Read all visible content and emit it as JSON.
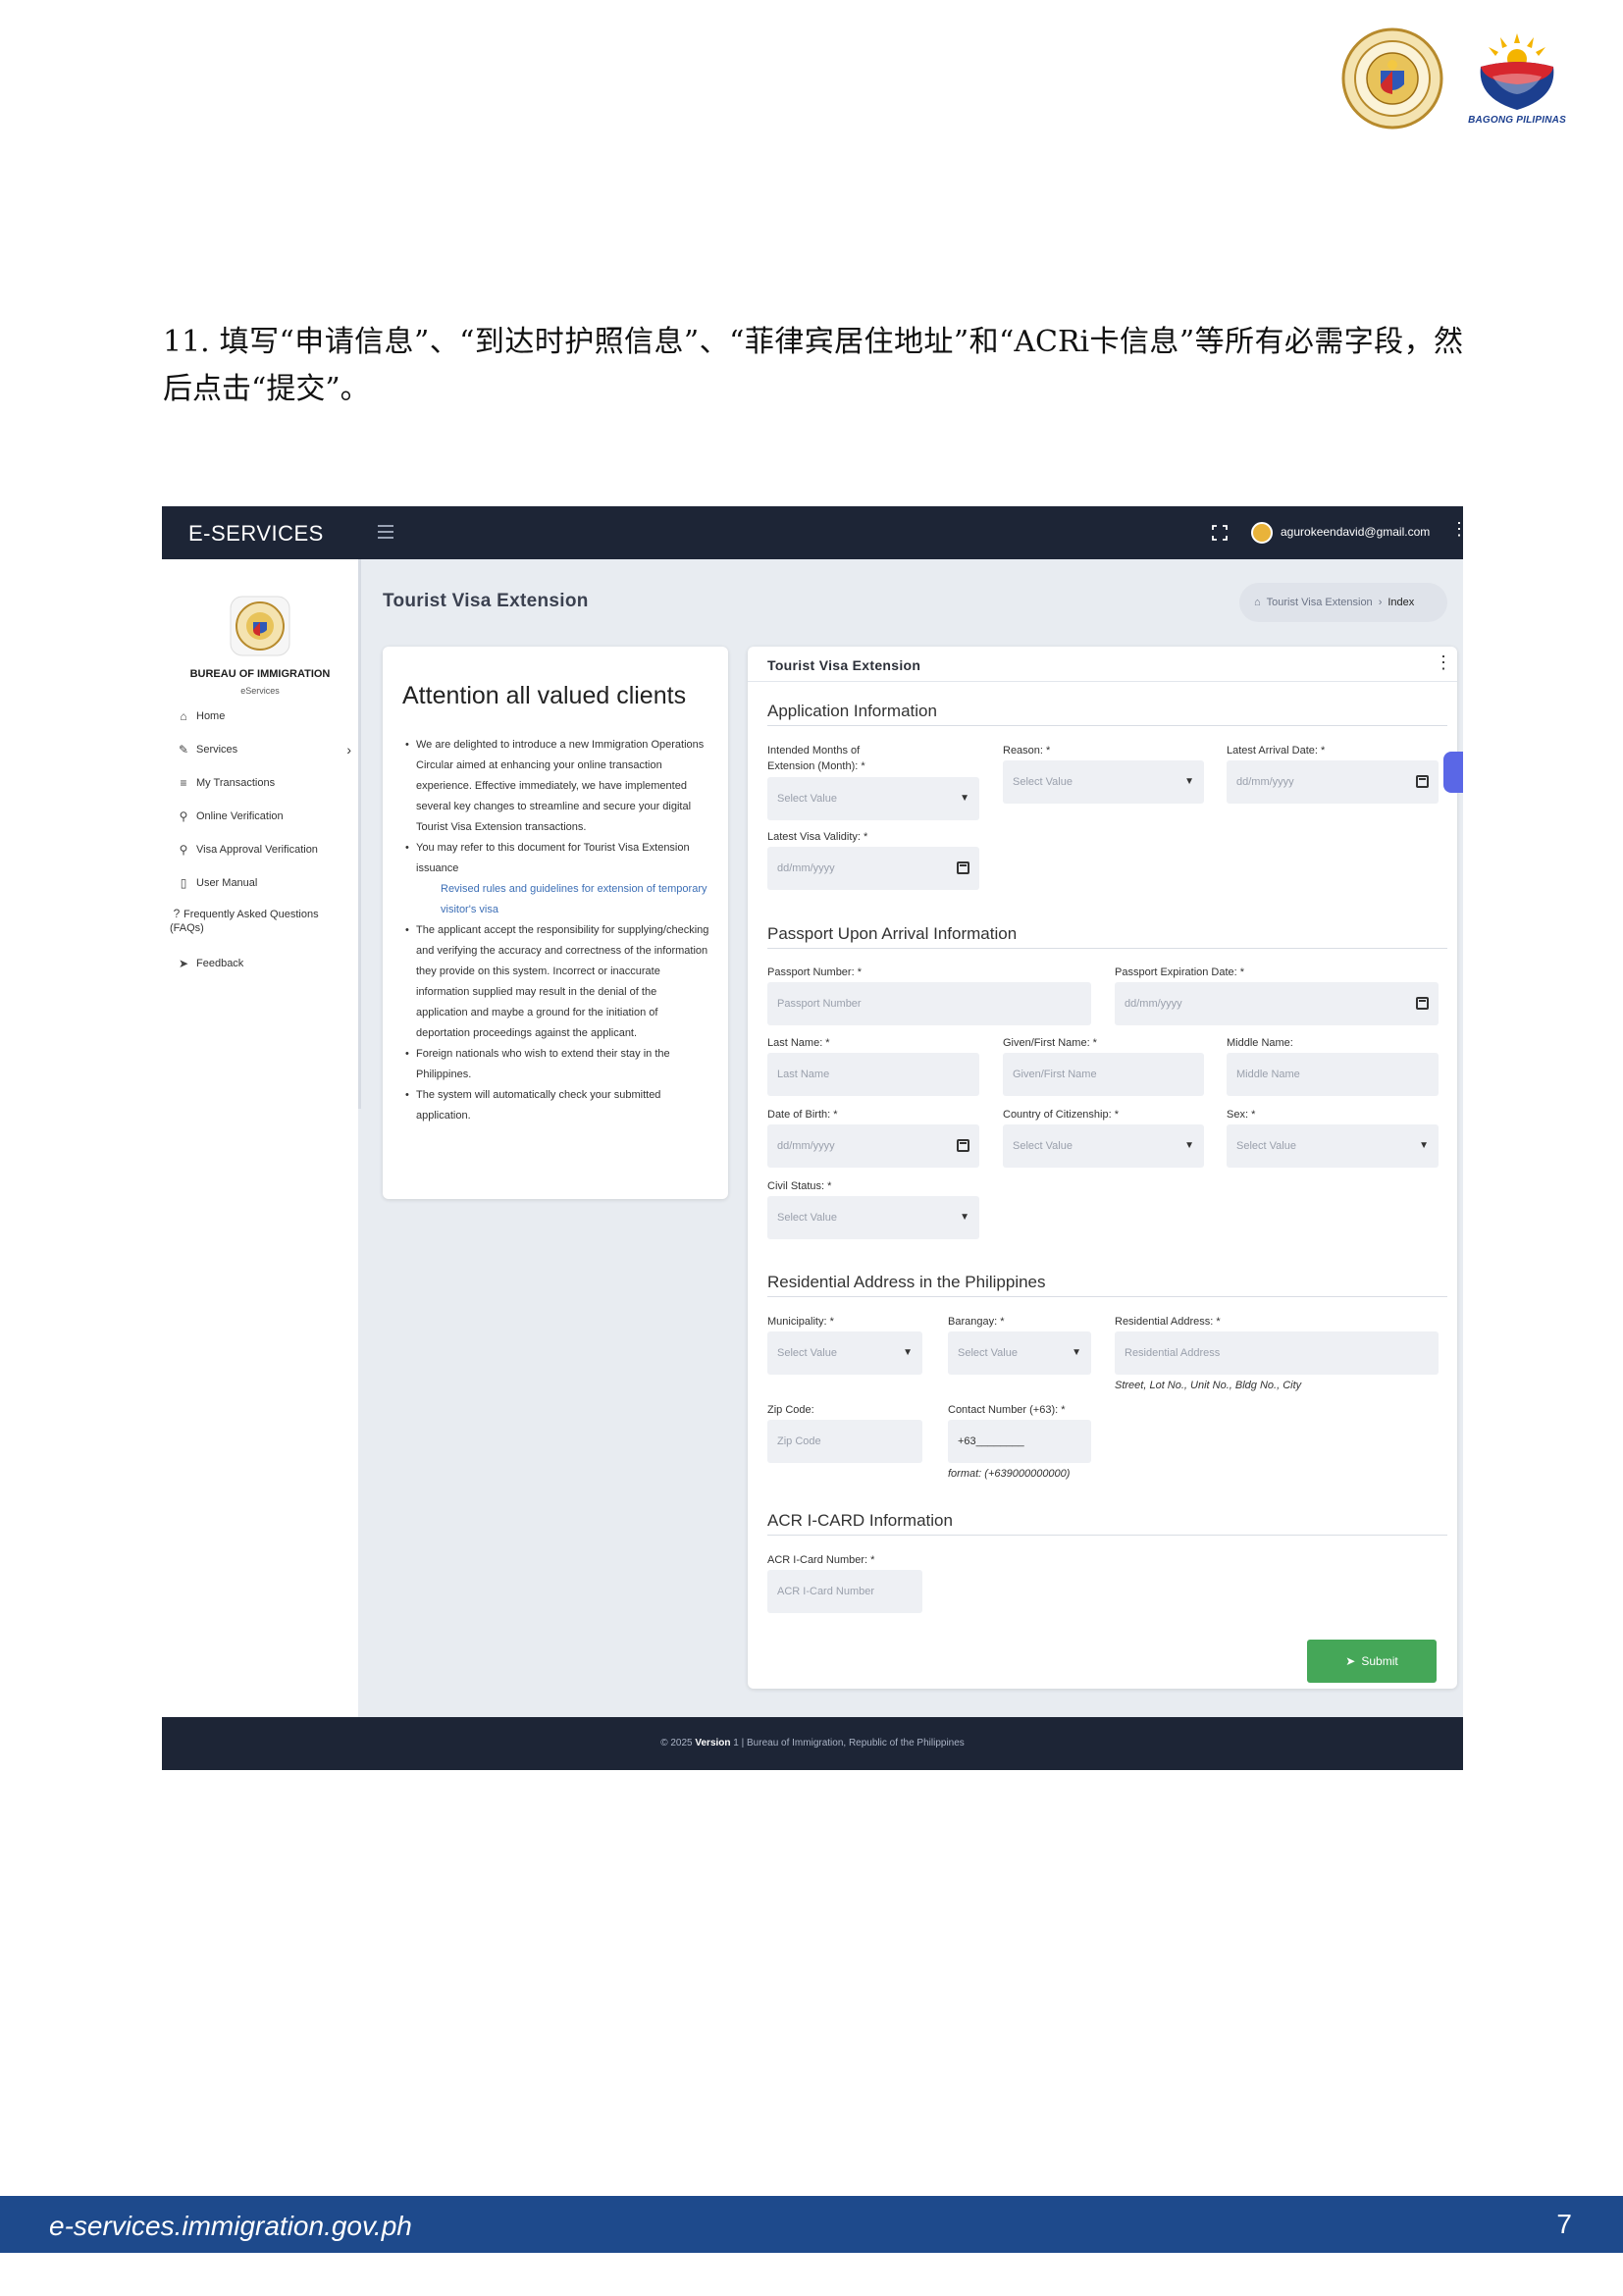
{
  "header": {
    "seal_name": "BUREAU OF IMMIGRATION",
    "seal_sub": "DEPARTMENT OF JUSTICE",
    "bagong_pilipinas": "BAGONG PILIPINAS"
  },
  "instruction": "11. 填写“申请信息”、“到达时护照信息”、“菲律宾居住地址”和“ACRi卡信息”等所有必需字段，然后点击“提交”。",
  "app": {
    "brand": "E-SERVICES",
    "user_email": "agurokeendavid@gmail.com",
    "sidebar": {
      "org_title": "BUREAU OF IMMIGRATION",
      "org_sub": "eServices",
      "items": [
        {
          "label": "Home",
          "icon": "home-icon"
        },
        {
          "label": "Services",
          "icon": "edit-icon"
        },
        {
          "label": "My Transactions",
          "icon": "list-icon"
        },
        {
          "label": "Online Verification",
          "icon": "search-icon"
        },
        {
          "label": "Visa Approval Verification",
          "icon": "search-icon"
        },
        {
          "label": "User Manual",
          "icon": "book-icon"
        },
        {
          "label": "Frequently Asked Questions (FAQs)",
          "icon": "question-icon"
        },
        {
          "label": "Feedback",
          "icon": "send-icon"
        }
      ]
    },
    "page_title": "Tourist Visa Extension",
    "breadcrumb": {
      "parent": "Tourist Visa Extension",
      "current": "Index"
    },
    "attention": {
      "title": "Attention all valued clients",
      "items": [
        "We are delighted to introduce a new Immigration Operations Circular aimed at enhancing your online transaction experience. Effective immediately, we have implemented several key changes to streamline and secure your digital Tourist Visa Extension transactions.",
        "You may refer to this document for Tourist Visa Extension issuance",
        "The applicant accept the responsibility for supplying/checking and verifying the accuracy and correctness of the information they provide on this system. Incorrect or inaccurate information supplied may result in the denial of the application and maybe a ground for the initiation of deportation proceedings against the applicant.",
        "Foreign nationals who wish to extend their stay in the Philippines.",
        "The system will automatically check your submitted application."
      ],
      "link": "Revised rules and guidelines for extension of temporary visitor's visa"
    },
    "form": {
      "header": "Tourist Visa Extension",
      "sec_application": "Application Information",
      "months_label": "Intended Months of Extension (Month): *",
      "reason_label": "Reason: *",
      "arrival_label": "Latest Arrival Date: *",
      "validity_label": "Latest Visa Validity: *",
      "sec_passport": "Passport Upon Arrival Information",
      "passport_no_label": "Passport Number: *",
      "passport_exp_label": "Passport Expiration Date: *",
      "last_name_label": "Last Name: *",
      "given_name_label": "Given/First Name: *",
      "middle_name_label": "Middle Name:",
      "dob_label": "Date of Birth: *",
      "citizenship_label": "Country of Citizenship: *",
      "sex_label": "Sex: *",
      "civil_label": "Civil Status: *",
      "sec_address": "Residential Address in the Philippines",
      "municipality_label": "Municipality: *",
      "barangay_label": "Barangay: *",
      "res_address_label": "Residential Address: *",
      "res_address_hint": "Street, Lot No., Unit No., Bldg No., City",
      "zip_label": "Zip Code:",
      "contact_label": "Contact Number (+63): *",
      "contact_value": "+63________",
      "contact_hint": "format: (+639000000000)",
      "sec_acr": "ACR I-CARD Information",
      "acr_label": "ACR I-Card Number: *",
      "ph_select": "Select Value",
      "ph_date": "dd/mm/yyyy",
      "ph_passport": "Passport Number",
      "ph_last": "Last Name",
      "ph_given": "Given/First Name",
      "ph_middle": "Middle Name",
      "ph_res": "Residential Address",
      "ph_zip": "Zip Code",
      "ph_acr": "ACR I-Card Number",
      "submit": "Submit"
    },
    "footer": {
      "prefix": "© 2025",
      "version": "Version",
      "rest": "1 | Bureau of Immigration, Republic of the Philippines"
    }
  },
  "page_footer": {
    "url": "e-services.immigration.gov.ph",
    "page": "7"
  }
}
